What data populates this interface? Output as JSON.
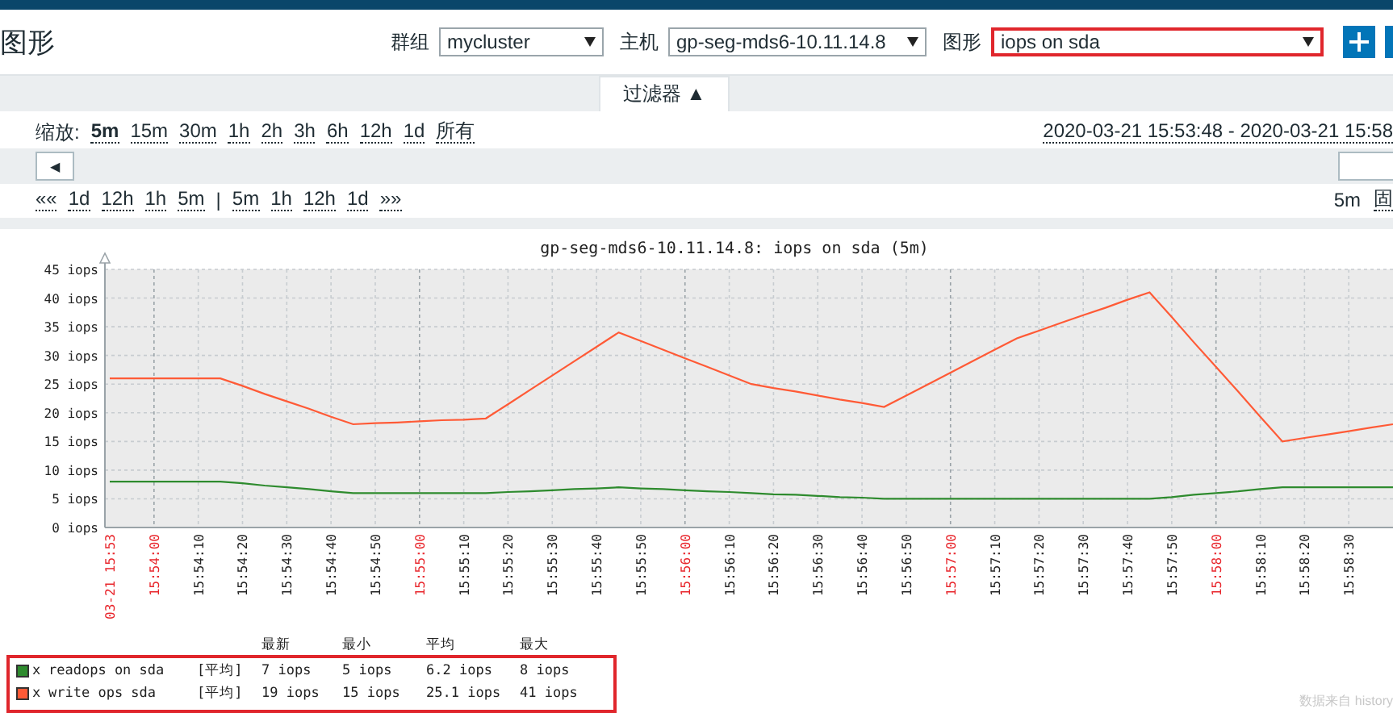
{
  "page_title": "图形",
  "filters": [
    {
      "label": "群组",
      "value": "mycluster",
      "highlighted": false
    },
    {
      "label": "主机",
      "value": "gp-seg-mds6-10.11.14.8",
      "highlighted": false
    },
    {
      "label": "图形",
      "value": "iops on sda",
      "highlighted": true
    }
  ],
  "filter_tab": {
    "label": "过滤器 ▲",
    "expanded": true
  },
  "zoom": {
    "label": "缩放:",
    "options": [
      {
        "label": "5m",
        "selected": true
      },
      {
        "label": "15m",
        "selected": false
      },
      {
        "label": "30m",
        "selected": false
      },
      {
        "label": "1h",
        "selected": false
      },
      {
        "label": "2h",
        "selected": false
      },
      {
        "label": "3h",
        "selected": false
      },
      {
        "label": "6h",
        "selected": false
      },
      {
        "label": "12h",
        "selected": false
      },
      {
        "label": "1d",
        "selected": false
      },
      {
        "label": "所有",
        "selected": false
      }
    ]
  },
  "time_range": "2020-03-21 15:53:48 - 2020-03-21 15:58",
  "scroll_left": "◀",
  "nav": [
    {
      "label": "««",
      "kind": "link"
    },
    {
      "label": "1d",
      "kind": "link"
    },
    {
      "label": "12h",
      "kind": "link"
    },
    {
      "label": "1h",
      "kind": "link"
    },
    {
      "label": "5m",
      "kind": "link"
    },
    {
      "label": "|",
      "kind": "separator"
    },
    {
      "label": "5m",
      "kind": "link"
    },
    {
      "label": "1h",
      "kind": "link"
    },
    {
      "label": "12h",
      "kind": "link"
    },
    {
      "label": "1d",
      "kind": "link"
    },
    {
      "label": "»»",
      "kind": "link"
    }
  ],
  "period": "5m",
  "fixed": "固",
  "chart": {
    "chart_data": {
      "type": "line",
      "title": "gp-seg-mds6-10.11.14.8: iops  on sda (5m)",
      "categories": [
        "03-21 15:53",
        null,
        "15:54:00",
        null,
        "15:54:10",
        null,
        "15:54:20",
        null,
        "15:54:30",
        null,
        "15:54:40",
        null,
        "15:54:50",
        null,
        "15:55:00",
        null,
        "15:55:10",
        null,
        "15:55:20",
        null,
        "15:55:30",
        null,
        "15:55:40",
        null,
        "15:55:50",
        null,
        "15:56:00",
        null,
        "15:56:10",
        null,
        "15:56:20",
        null,
        "15:56:30",
        null,
        "15:56:40",
        null,
        "15:56:50",
        null,
        "15:57:00",
        null,
        "15:57:10",
        null,
        "15:57:20",
        null,
        "15:57:30",
        null,
        "15:57:40",
        null,
        "15:57:50",
        null,
        "15:58:00",
        null,
        "15:58:10",
        null,
        "15:58:20",
        null,
        "15:58:30",
        null,
        null
      ],
      "ylim": [
        0,
        45
      ],
      "grid": true,
      "yticks": [
        {
          "value": 0,
          "label": "0 iops"
        },
        {
          "value": 5,
          "label": "5 iops"
        },
        {
          "value": 10,
          "label": "10 iops"
        },
        {
          "value": 15,
          "label": "15 iops"
        },
        {
          "value": 20,
          "label": "20 iops"
        },
        {
          "value": 25,
          "label": "25 iops"
        },
        {
          "value": 30,
          "label": "30 iops"
        },
        {
          "value": 35,
          "label": "35 iops"
        },
        {
          "value": 40,
          "label": "40 iops"
        },
        {
          "value": 45,
          "label": "45 iops"
        }
      ],
      "series": [
        {
          "name": "readops on sda",
          "color": "#2e8b2e",
          "values": [
            8,
            8,
            8,
            8,
            8,
            8,
            7.7,
            7.3,
            7,
            6.7,
            6.3,
            6,
            6,
            6,
            6,
            6,
            6,
            6,
            6.2,
            6.3,
            6.5,
            6.7,
            6.8,
            7,
            6.8,
            6.7,
            6.5,
            6.3,
            6.2,
            6,
            5.8,
            5.7,
            5.5,
            5.3,
            5.2,
            5,
            5,
            5,
            5,
            5,
            5,
            5,
            5,
            5,
            5,
            5,
            5,
            5,
            5.3,
            5.7,
            6,
            6.3,
            6.7,
            7,
            7,
            7,
            7,
            7,
            7
          ]
        },
        {
          "name": "write ops sda",
          "color": "#ff5a36",
          "values": [
            26,
            26,
            26,
            26,
            26,
            26,
            24.7,
            23.3,
            22,
            20.7,
            19.3,
            18,
            18.2,
            18.3,
            18.5,
            18.7,
            18.8,
            19,
            21.5,
            24,
            26.5,
            29,
            31.5,
            34,
            32.5,
            31,
            29.5,
            28,
            26.5,
            25,
            24.3,
            23.7,
            23,
            22.3,
            21.7,
            21,
            23,
            25,
            27,
            29,
            31,
            33,
            34.3,
            35.7,
            37,
            38.3,
            39.7,
            41,
            36.7,
            32.3,
            28,
            23.7,
            19.3,
            15,
            15.6,
            16.2,
            16.8,
            17.4,
            18
          ]
        }
      ]
    },
    "legend": {
      "headers": [
        "最新",
        "最小",
        "平均",
        "最大"
      ],
      "highlighted": true,
      "rows": [
        {
          "prefix": "x",
          "function": "[平均]",
          "last": "7 iops",
          "min": "5 iops",
          "avg": "6.2 iops",
          "max": "8 iops",
          "color": "#2e8b2e"
        },
        {
          "prefix": "x",
          "function": "[平均]",
          "last": "19 iops",
          "min": "15 iops",
          "avg": "25.1 iops",
          "max": "41 iops",
          "color": "#ff5a36"
        }
      ]
    },
    "source_note": "数据来自 history"
  }
}
